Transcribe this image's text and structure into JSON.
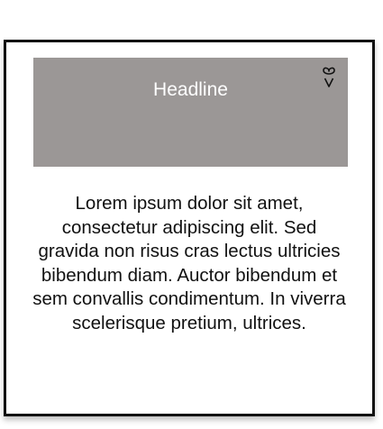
{
  "card": {
    "headline": "Headline",
    "body": "Lorem ipsum dolor sit amet, consectetur adipiscing elit. Sed gravida non risus cras lectus ultricies bibendum diam. Auctor bibendum et sem convallis condimentum. In viverra scelerisque pretium, ultrices.",
    "icon": "heart-icon"
  },
  "colors": {
    "banner": "#9b9796",
    "headline_text": "#ffffff",
    "card_border": "#111111",
    "body_text": "#111111"
  }
}
